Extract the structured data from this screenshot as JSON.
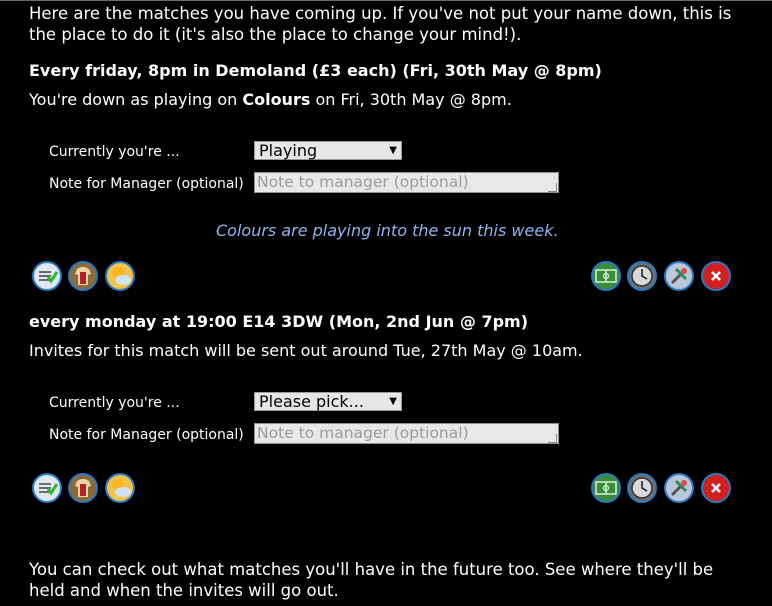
{
  "intro": "Here are the matches you have coming up. If you've not put your name down, this is the place to do it (it's also the place to change your mind!).",
  "matches": [
    {
      "title": "Every friday, 8pm in Demoland (£3 each) (Fri, 30th May @ 8pm)",
      "status_prefix": "You're down as playing on ",
      "status_team": "Colours",
      "status_suffix": " on Fri, 30th May @ 8pm.",
      "current_label": "Currently you're ...",
      "current_value": "Playing",
      "note_label": "Note for Manager (optional)",
      "note_placeholder": "Note to manager (optional)",
      "conditions": "Colours are playing into the sun this week."
    },
    {
      "title": "every monday at 19:00 E14 3DW (Mon, 2nd Jun @ 7pm)",
      "status_text": "Invites for this match will be sent out around Tue, 27th May @ 10am.",
      "current_label": "Currently you're ...",
      "current_value": "Please pick...",
      "note_label": "Note for Manager (optional)",
      "note_placeholder": "Note to manager (optional)"
    }
  ],
  "icons": {
    "left": [
      "checklist-icon",
      "shirt-icon",
      "weather-icon"
    ],
    "right": [
      "pitch-icon",
      "clock-icon",
      "tools-icon",
      "cancel-icon"
    ]
  },
  "footer": "You can check out what matches you'll have in the future too. See where they'll be held and when the invites will go out."
}
